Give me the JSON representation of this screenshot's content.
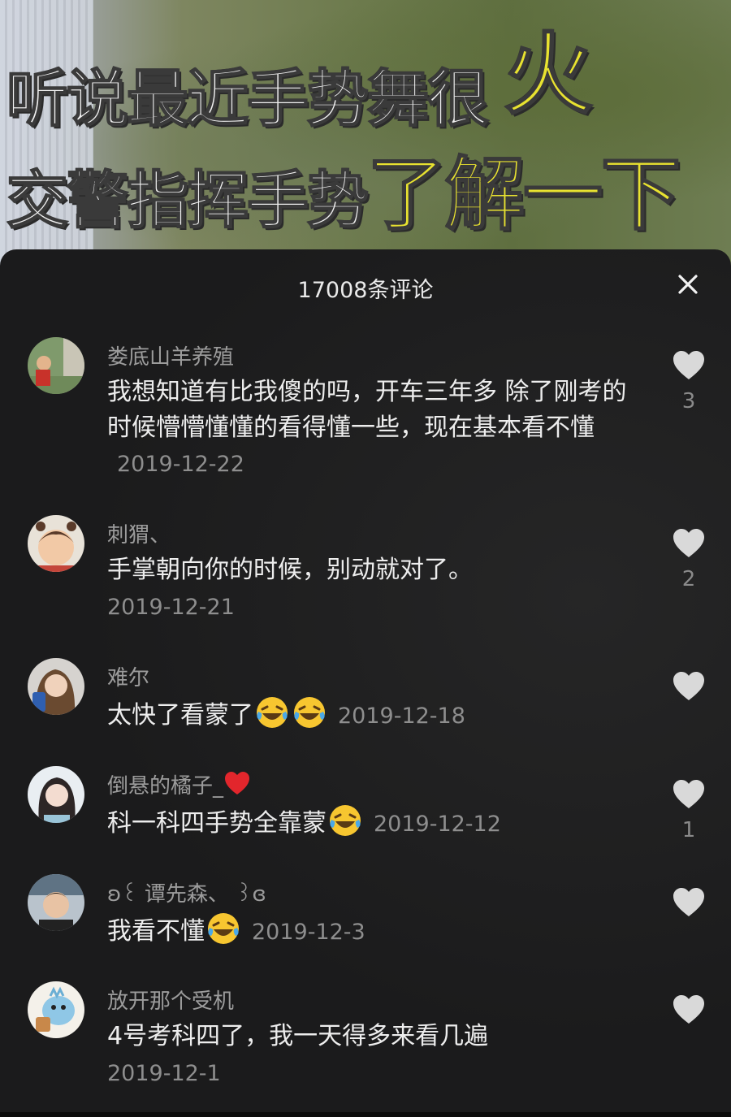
{
  "video_overlay": {
    "line1_white": "听说最近手势舞很",
    "line1_yellow": "火",
    "line2_white": "交警指挥手势",
    "line2_yellow": "了解一下"
  },
  "comments_panel": {
    "title": "17008条评论",
    "close_icon": "close-icon"
  },
  "comments": [
    {
      "user": "娄底山羊养殖",
      "text": "我想知道有比我傻的吗，开车三年多 除了刚考的时候懵懵懂懂的看得懂一些，现在基本看不懂",
      "date": "2019-12-22",
      "likes": "3"
    },
    {
      "user": "刺猬、",
      "text": "手掌朝向你的时候，别动就对了。",
      "date": "2019-12-21",
      "likes": "2"
    },
    {
      "user": "难尔",
      "text": "太快了看蒙了",
      "date": "2019-12-18",
      "likes": ""
    },
    {
      "user": "倒悬的橘子_",
      "text": "科一科四手势全靠蒙",
      "date": "2019-12-12",
      "likes": "1"
    },
    {
      "user_left_deco": "ʚ꒰",
      "user": "谭先森、",
      "user_right_deco": "꒱ɞ",
      "text": "我看不懂",
      "date": "2019-12-3",
      "likes": ""
    },
    {
      "user": "放开那个受机",
      "text": "4号考科四了，我一天得多来看几遍",
      "date": "2019-12-1",
      "likes": ""
    }
  ],
  "colors": {
    "sheet_bg": "#1b1b1c",
    "username": "#9c9c9c",
    "text": "#ededed",
    "date": "#8e8e8e",
    "like_icon": "#d9d9d9",
    "overlay_yellow": "#e8e230"
  }
}
